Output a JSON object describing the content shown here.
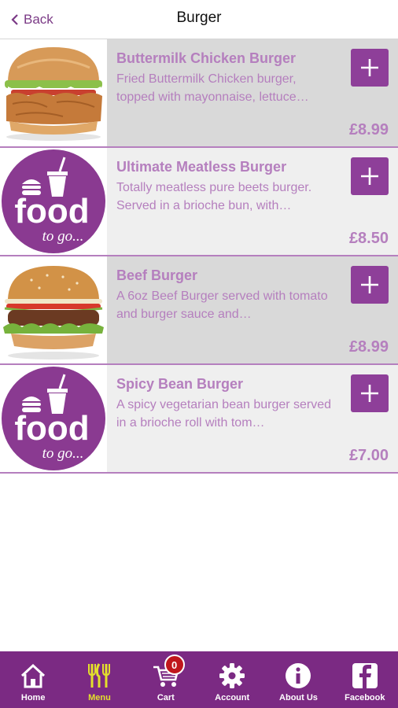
{
  "header": {
    "back_label": "Back",
    "title": "Burger"
  },
  "items": [
    {
      "name": "Buttermilk Chicken Burger",
      "description": "Fried Buttermilk Chicken burger, topped with mayonnaise, lettuce…",
      "price": "£8.99",
      "image": "chicken-burger-photo"
    },
    {
      "name": "Ultimate Meatless Burger",
      "description": "Totally meatless pure beets burger. Served in a brioche bun, with…",
      "price": "£8.50",
      "image": "food-to-go-logo",
      "logo_word": "food",
      "logo_tag": "to go..."
    },
    {
      "name": "Beef Burger",
      "description": "A 6oz Beef Burger served with tomato and burger sauce and…",
      "price": "£8.99",
      "image": "beef-burger-photo"
    },
    {
      "name": "Spicy Bean Burger",
      "description": "A spicy vegetarian bean burger served in a brioche roll with tom…",
      "price": "£7.00",
      "image": "food-to-go-logo",
      "logo_word": "food",
      "logo_tag": "to go..."
    }
  ],
  "tabs": [
    {
      "label": "Home",
      "icon": "home-icon"
    },
    {
      "label": "Menu",
      "icon": "cutlery-icon",
      "active": true
    },
    {
      "label": "Cart",
      "icon": "cart-icon",
      "badge": "0"
    },
    {
      "label": "Account",
      "icon": "gear-icon"
    },
    {
      "label": "About Us",
      "icon": "info-icon"
    },
    {
      "label": "Facebook",
      "icon": "facebook-icon"
    }
  ],
  "colors": {
    "brand": "#7b2a83",
    "accent_text": "#b57fbe",
    "active_tab": "#e3e02b",
    "badge": "#c0171c"
  }
}
